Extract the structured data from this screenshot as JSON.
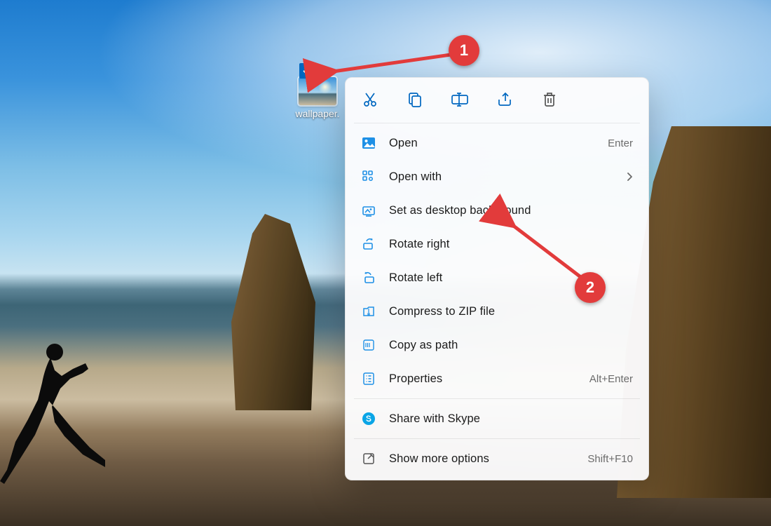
{
  "desktop_icon": {
    "label": "wallpaper.",
    "selected": true
  },
  "context_menu": {
    "quick_actions": {
      "cut": "cut-icon",
      "copy": "copy-icon",
      "rename": "rename-icon",
      "share": "share-icon",
      "delete": "delete-icon"
    },
    "items": [
      {
        "id": "open",
        "label": "Open",
        "accelerator": "Enter",
        "icon": "image-icon"
      },
      {
        "id": "open-with",
        "label": "Open with",
        "submenu": true,
        "icon": "open-with-icon"
      },
      {
        "id": "set-bg",
        "label": "Set as desktop background",
        "icon": "set-desktop-bg-icon"
      },
      {
        "id": "rotate-right",
        "label": "Rotate right",
        "icon": "rotate-right-icon"
      },
      {
        "id": "rotate-left",
        "label": "Rotate left",
        "icon": "rotate-left-icon"
      },
      {
        "id": "zip",
        "label": "Compress to ZIP file",
        "icon": "zip-icon"
      },
      {
        "id": "copy-path",
        "label": "Copy as path",
        "icon": "copy-path-icon"
      },
      {
        "id": "properties",
        "label": "Properties",
        "accelerator": "Alt+Enter",
        "icon": "properties-icon"
      },
      {
        "id": "skype",
        "label": "Share with Skype",
        "icon": "skype-icon"
      },
      {
        "id": "more",
        "label": "Show more options",
        "accelerator": "Shift+F10",
        "icon": "more-options-icon"
      }
    ]
  },
  "annotations": {
    "badge1": "1",
    "badge2": "2"
  }
}
